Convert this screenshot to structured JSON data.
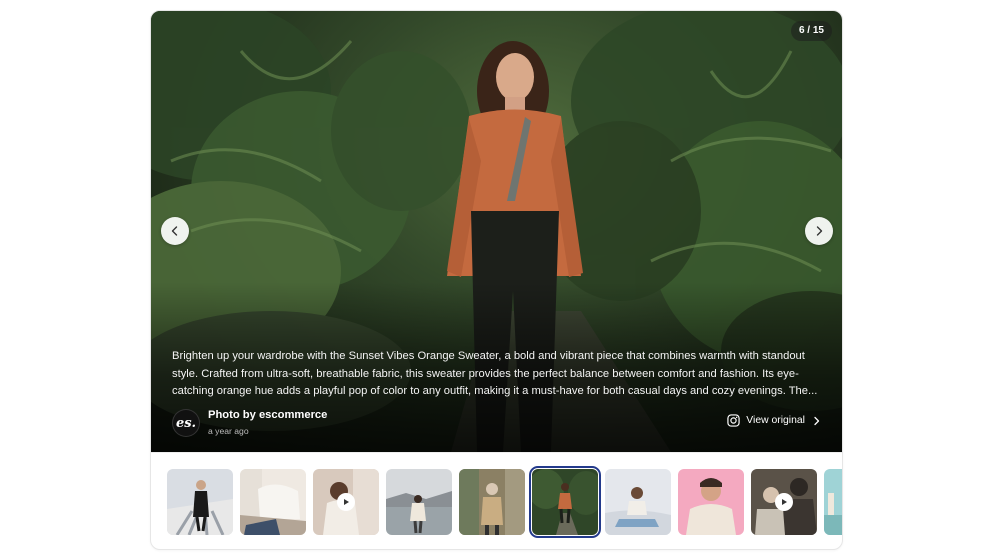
{
  "gallery": {
    "counter": "6 / 15",
    "caption": "Brighten up your wardrobe with the Sunset Vibes Orange Sweater, a bold and vibrant piece that combines warmth with standout style. Crafted from ultra-soft, breathable fabric, this sweater provides the perfect balance between comfort and fashion. Its eye-catching orange hue adds a playful pop of color to any outfit, making it a must-have for both casual days and cozy evenings. The...",
    "credit": {
      "avatar_text": "es.",
      "name": "Photo by escommerce",
      "time": "a year ago"
    },
    "view_original": "View original",
    "icons": {
      "prev": "chevron-left-icon",
      "next": "chevron-right-icon",
      "source": "instagram-icon",
      "link": "chevron-right-icon",
      "video": "play-icon"
    }
  },
  "thumbnails": [
    {
      "id": "1",
      "video": false,
      "selected": false
    },
    {
      "id": "2",
      "video": false,
      "selected": false
    },
    {
      "id": "3",
      "video": true,
      "selected": false
    },
    {
      "id": "4",
      "video": false,
      "selected": false
    },
    {
      "id": "5",
      "video": false,
      "selected": false
    },
    {
      "id": "6",
      "video": false,
      "selected": true
    },
    {
      "id": "7",
      "video": false,
      "selected": false
    },
    {
      "id": "8",
      "video": false,
      "selected": false
    },
    {
      "id": "9",
      "video": true,
      "selected": false
    },
    {
      "id": "10",
      "video": false,
      "selected": false
    }
  ],
  "colors": {
    "selected_outline": "#233a8c",
    "sweater": "#c46a3f"
  }
}
